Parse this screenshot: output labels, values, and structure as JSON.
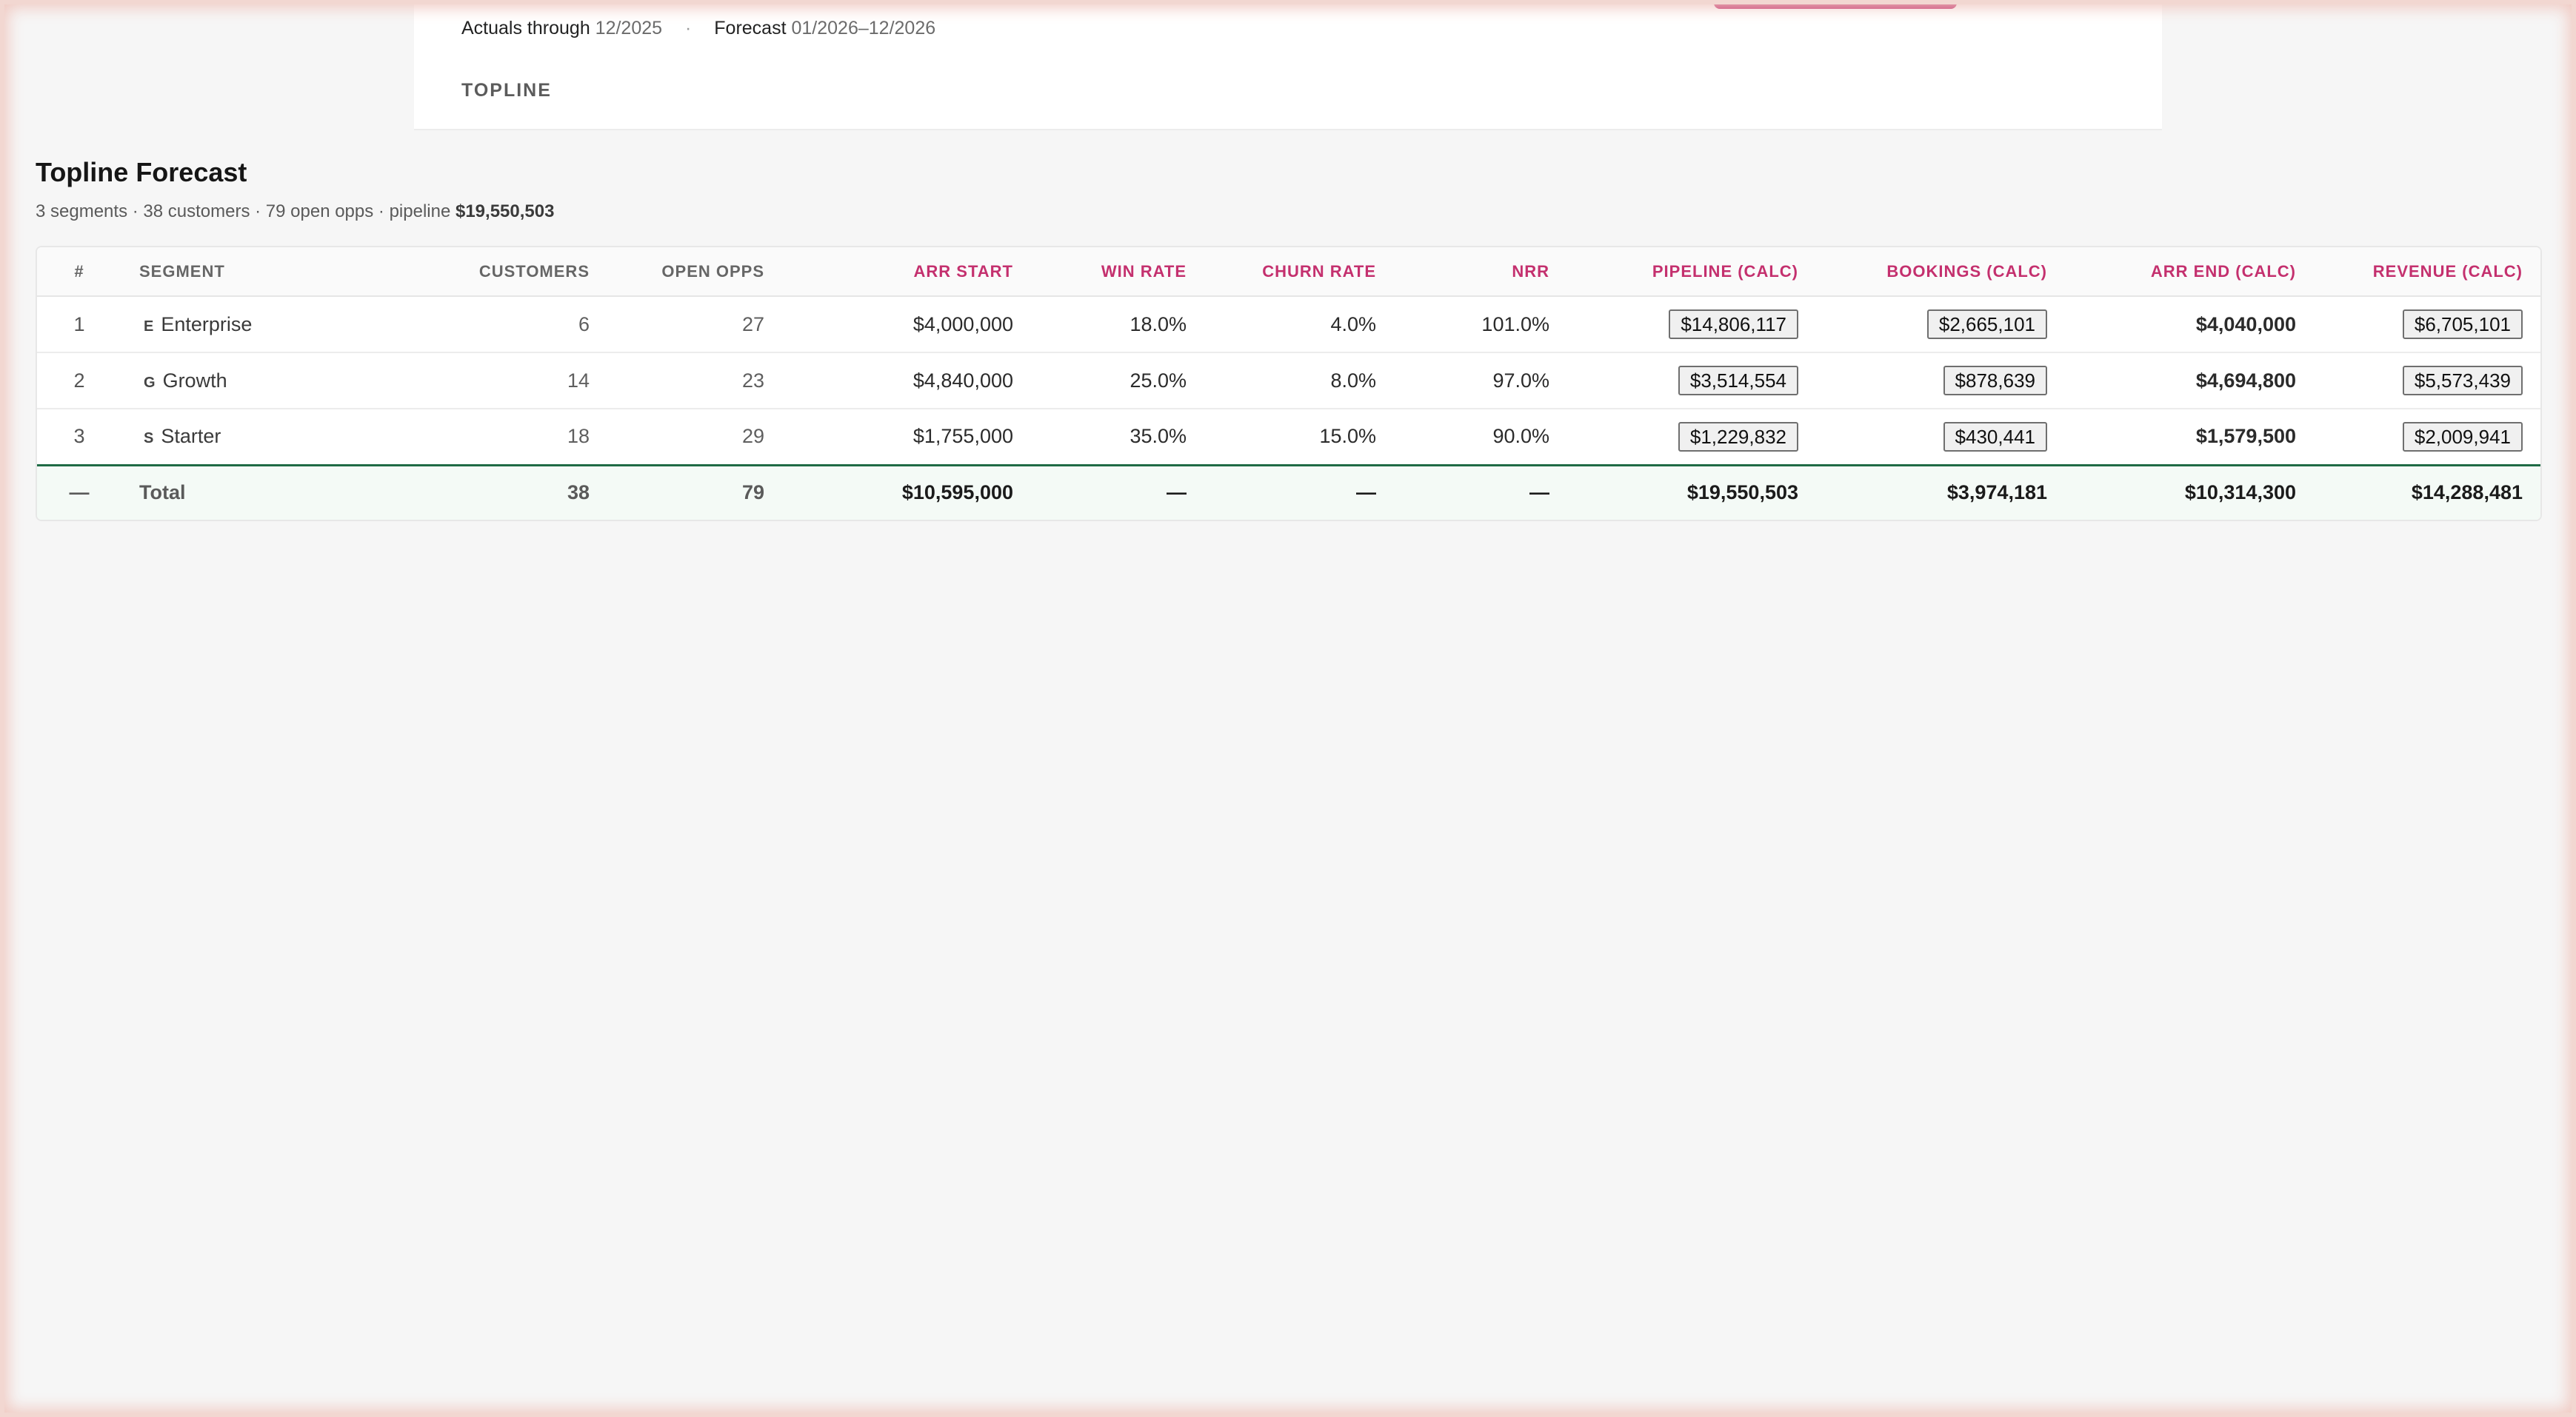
{
  "header": {
    "actuals_label": "Actuals through",
    "actuals_value": "12/2025",
    "separator": "·",
    "forecast_label": "Forecast",
    "forecast_value": "01/2026–12/2026",
    "tab": "TOPLINE"
  },
  "page": {
    "title": "Topline Forecast",
    "summary_prefix": "3 segments · 38 customers · 79 open opps · pipeline",
    "summary_pipeline": "$19,550,503"
  },
  "table": {
    "headers": {
      "num": "#",
      "segment": "SEGMENT",
      "customers": "CUSTOMERS",
      "open_opps": "OPEN OPPS",
      "arr_start": "ARR START",
      "win_rate": "WIN RATE",
      "churn_rate": "CHURN RATE",
      "nrr": "NRR",
      "pipeline": "PIPELINE (CALC)",
      "bookings": "BOOKINGS (CALC)",
      "arr_end": "ARR END (CALC)",
      "revenue": "REVENUE (CALC)"
    },
    "rows": [
      {
        "num": "1",
        "letter": "E",
        "segment": "Enterprise",
        "customers": "6",
        "open_opps": "27",
        "arr_start": "$4,000,000",
        "win_rate": "18.0%",
        "churn_rate": "4.0%",
        "nrr": "101.0%",
        "pipeline": "$14,806,117",
        "bookings": "$2,665,101",
        "arr_end": "$4,040,000",
        "revenue": "$6,705,101"
      },
      {
        "num": "2",
        "letter": "G",
        "segment": "Growth",
        "customers": "14",
        "open_opps": "23",
        "arr_start": "$4,840,000",
        "win_rate": "25.0%",
        "churn_rate": "8.0%",
        "nrr": "97.0%",
        "pipeline": "$3,514,554",
        "bookings": "$878,639",
        "arr_end": "$4,694,800",
        "revenue": "$5,573,439"
      },
      {
        "num": "3",
        "letter": "S",
        "segment": "Starter",
        "customers": "18",
        "open_opps": "29",
        "arr_start": "$1,755,000",
        "win_rate": "35.0%",
        "churn_rate": "15.0%",
        "nrr": "90.0%",
        "pipeline": "$1,229,832",
        "bookings": "$430,441",
        "arr_end": "$1,579,500",
        "revenue": "$2,009,941"
      }
    ],
    "total": {
      "num": "—",
      "segment": "Total",
      "customers": "38",
      "open_opps": "79",
      "arr_start": "$10,595,000",
      "win_rate": "—",
      "churn_rate": "—",
      "nrr": "—",
      "pipeline": "$19,550,503",
      "bookings": "$3,974,181",
      "arr_end": "$10,314,300",
      "revenue": "$14,288,481"
    }
  },
  "colors": {
    "accent": "#c4306e",
    "total_border": "#1f6b45"
  }
}
